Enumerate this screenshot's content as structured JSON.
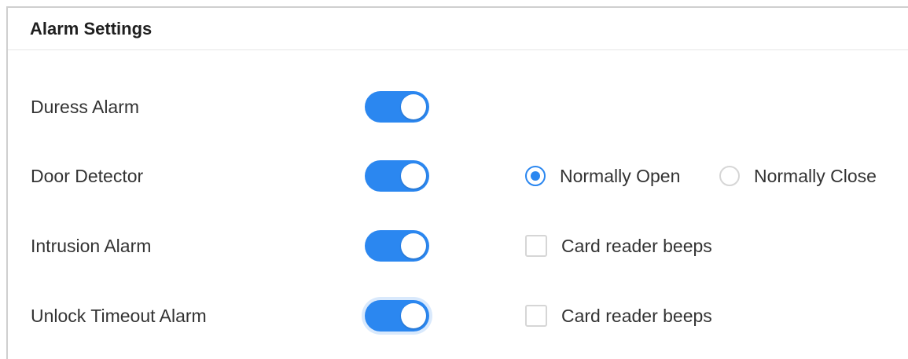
{
  "panel": {
    "title": "Alarm Settings"
  },
  "rows": [
    {
      "label": "Duress Alarm",
      "toggle_on": true
    },
    {
      "label": "Door Detector",
      "toggle_on": true,
      "radio_options": [
        {
          "label": "Normally Open",
          "selected": true
        },
        {
          "label": "Normally Close",
          "selected": false
        }
      ]
    },
    {
      "label": "Intrusion Alarm",
      "toggle_on": true,
      "checkbox": {
        "label": "Card reader beeps",
        "checked": false
      }
    },
    {
      "label": "Unlock Timeout Alarm",
      "toggle_on": true,
      "checkbox": {
        "label": "Card reader beeps",
        "checked": false
      }
    }
  ],
  "colors": {
    "accent": "#2b87f0",
    "border": "#d6d6d6",
    "text": "#333333"
  }
}
